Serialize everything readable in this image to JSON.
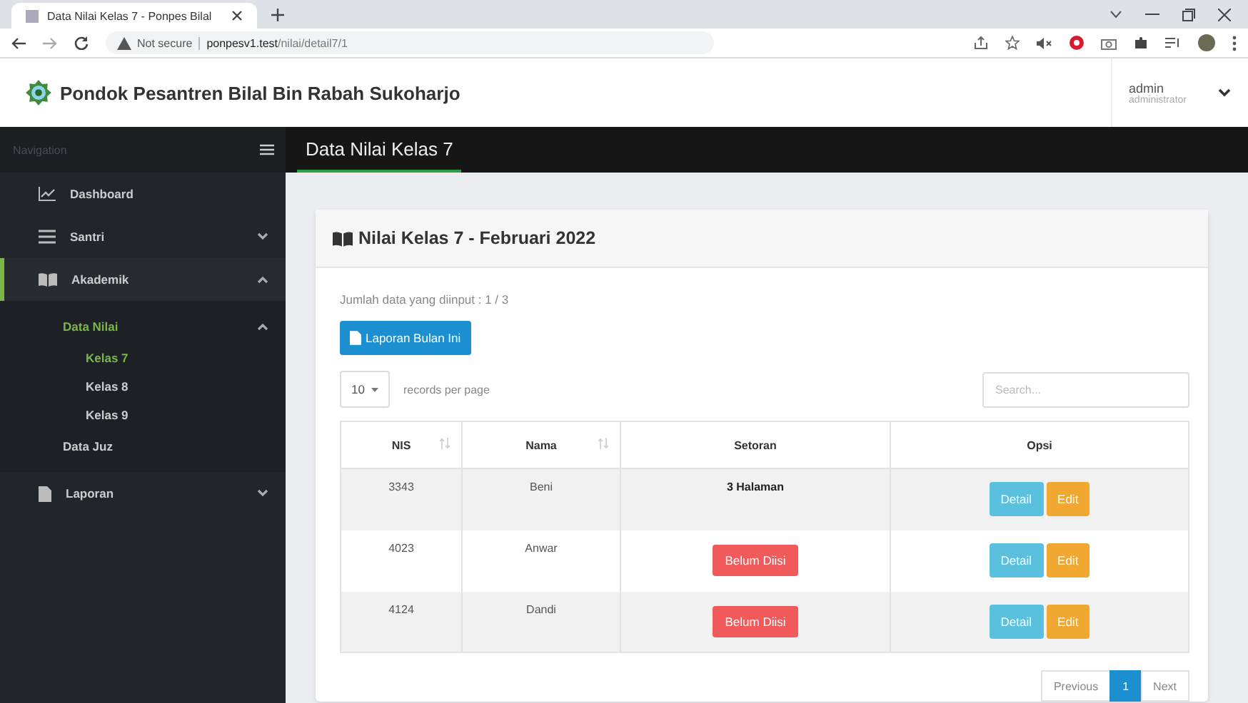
{
  "browser": {
    "tab_title": "Data Nilai Kelas 7 - Ponpes Bilal",
    "security": "Not secure",
    "url_host": "ponpesv1.test",
    "url_path": "/nilai/detail7/1"
  },
  "header": {
    "brand": "Pondok Pesantren Bilal Bin Rabah Sukoharjo",
    "user_name": "admin",
    "user_role": "administrator"
  },
  "sidebar": {
    "heading": "Navigation",
    "items": [
      {
        "label": "Dashboard",
        "selected": false
      },
      {
        "label": "Santri",
        "selected": false,
        "expanded": false
      },
      {
        "label": "Akademik",
        "selected": true,
        "expanded": true,
        "children": [
          {
            "label": "Data Nilai",
            "selected": true,
            "expanded": true,
            "children": [
              {
                "label": "Kelas 7",
                "selected": true
              },
              {
                "label": "Kelas 8",
                "selected": false
              },
              {
                "label": "Kelas 9",
                "selected": false
              }
            ]
          },
          {
            "label": "Data Juz",
            "selected": false
          }
        ]
      },
      {
        "label": "Laporan",
        "selected": false,
        "expanded": false
      }
    ]
  },
  "page_title": "Data Nilai Kelas 7",
  "card": {
    "title": "Nilai Kelas 7 - Februari 2022",
    "summary": "Jumlah data yang diinput : 1 / 3",
    "report_button": "Laporan Bulan Ini",
    "page_length": "10",
    "length_label": "records per page",
    "search": {
      "placeholder": "Search..."
    },
    "table": {
      "columns": [
        {
          "label": "NIS",
          "sortable": true
        },
        {
          "label": "Nama",
          "sortable": true
        },
        {
          "label": "Setoran",
          "sortable": false
        },
        {
          "label": "Opsi",
          "sortable": false
        }
      ],
      "rows": [
        {
          "nis": "3343",
          "nama": "Beni",
          "setoran": {
            "kind": "text",
            "label": "3 Halaman"
          },
          "actions": [
            "Detail",
            "Edit"
          ]
        },
        {
          "nis": "4023",
          "nama": "Anwar",
          "setoran": {
            "kind": "badge",
            "label": "Belum Diisi"
          },
          "actions": [
            "Detail",
            "Edit"
          ]
        },
        {
          "nis": "4124",
          "nama": "Dandi",
          "setoran": {
            "kind": "badge",
            "label": "Belum Diisi"
          },
          "actions": [
            "Detail",
            "Edit"
          ]
        }
      ]
    },
    "pagination": {
      "previous": "Previous",
      "pages": [
        {
          "label": "1",
          "selected": true
        }
      ],
      "next": "Next"
    }
  }
}
